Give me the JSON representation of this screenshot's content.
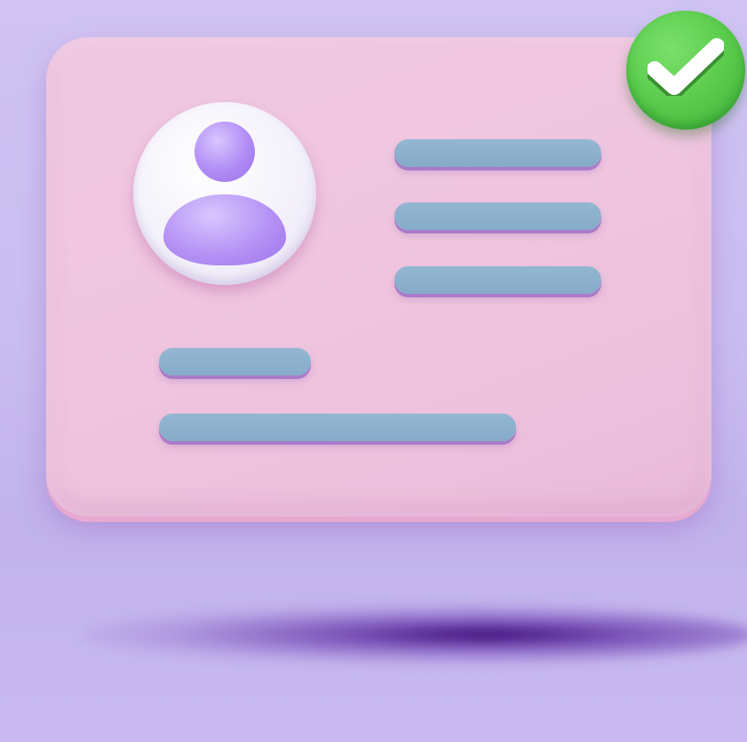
{
  "scene": {
    "description_label": "",
    "colors": {
      "background": "#cabdf0",
      "card": "#efc5df",
      "avatar_circle": "#f3f0fa",
      "avatar_figure": "#b08cf4",
      "text_bar": "#8cb1ce",
      "check_badge": "#57c94a",
      "check_mark": "#ffffff",
      "floor_shadow": "#30006e"
    },
    "icons": {
      "avatar": "user-avatar-icon",
      "badge": "check-icon"
    },
    "placeholder_bars": [
      {
        "name": "detail-line-1"
      },
      {
        "name": "detail-line-2"
      },
      {
        "name": "detail-line-3"
      },
      {
        "name": "detail-line-4"
      },
      {
        "name": "detail-line-5"
      }
    ]
  }
}
